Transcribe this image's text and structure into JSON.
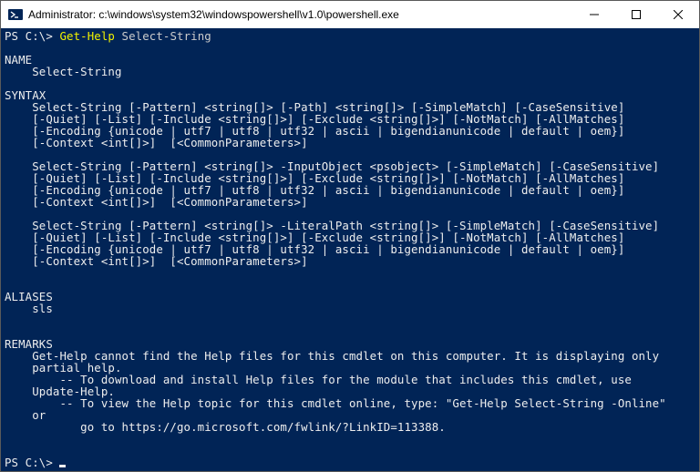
{
  "window": {
    "title": "Administrator: c:\\windows\\system32\\windowspowershell\\v1.0\\powershell.exe"
  },
  "icons": {
    "ps": "powershell-icon",
    "minimize": "minimize-icon",
    "maximize": "maximize-icon",
    "close": "close-icon"
  },
  "terminal": {
    "prompt1_prefix": "PS C:\\> ",
    "prompt1_cmd": "Get-Help ",
    "prompt1_arg": "Select-String",
    "blank": "",
    "name_hdr": "NAME",
    "name_val": "    Select-String",
    "syntax_hdr": "SYNTAX",
    "syntax_block1_l1": "    Select-String [-Pattern] <string[]> [-Path] <string[]> [-SimpleMatch] [-CaseSensitive]",
    "syntax_block1_l2": "    [-Quiet] [-List] [-Include <string[]>] [-Exclude <string[]>] [-NotMatch] [-AllMatches]",
    "syntax_block1_l3": "    [-Encoding {unicode | utf7 | utf8 | utf32 | ascii | bigendianunicode | default | oem}]",
    "syntax_block1_l4": "    [-Context <int[]>]  [<CommonParameters>]",
    "syntax_block2_l1": "    Select-String [-Pattern] <string[]> -InputObject <psobject> [-SimpleMatch] [-CaseSensitive]",
    "syntax_block2_l2": "    [-Quiet] [-List] [-Include <string[]>] [-Exclude <string[]>] [-NotMatch] [-AllMatches]",
    "syntax_block2_l3": "    [-Encoding {unicode | utf7 | utf8 | utf32 | ascii | bigendianunicode | default | oem}]",
    "syntax_block2_l4": "    [-Context <int[]>]  [<CommonParameters>]",
    "syntax_block3_l1": "    Select-String [-Pattern] <string[]> -LiteralPath <string[]> [-SimpleMatch] [-CaseSensitive]",
    "syntax_block3_l2": "    [-Quiet] [-List] [-Include <string[]>] [-Exclude <string[]>] [-NotMatch] [-AllMatches]",
    "syntax_block3_l3": "    [-Encoding {unicode | utf7 | utf8 | utf32 | ascii | bigendianunicode | default | oem}]",
    "syntax_block3_l4": "    [-Context <int[]>]  [<CommonParameters>]",
    "aliases_hdr": "ALIASES",
    "aliases_val": "    sls",
    "remarks_hdr": "REMARKS",
    "remarks_l1": "    Get-Help cannot find the Help files for this cmdlet on this computer. It is displaying only",
    "remarks_l2": "    partial help.",
    "remarks_l3": "        -- To download and install Help files for the module that includes this cmdlet, use",
    "remarks_l4": "    Update-Help.",
    "remarks_l5": "        -- To view the Help topic for this cmdlet online, type: \"Get-Help Select-String -Online\"",
    "remarks_l6": "    or",
    "remarks_l7": "           go to https://go.microsoft.com/fwlink/?LinkID=113388.",
    "prompt2_prefix": "PS C:\\> "
  }
}
